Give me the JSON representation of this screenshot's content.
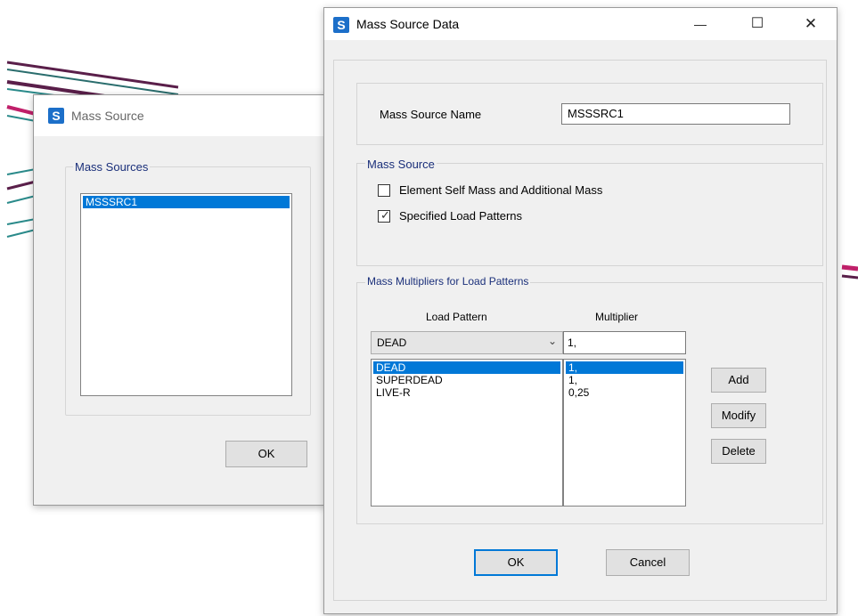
{
  "background_window": {
    "title": "Mass Source",
    "group_title": "Mass Sources",
    "list_items": [
      "MSSSRC1"
    ],
    "ok_label": "OK"
  },
  "dialog": {
    "title": "Mass Source Data",
    "minimize_glyph": "—",
    "maximize_glyph": "☐",
    "close_glyph": "✕",
    "name_label": "Mass Source Name",
    "name_value": "MSSSRC1",
    "mass_source_group": "Mass Source",
    "options": [
      {
        "label": "Element Self Mass and Additional Mass",
        "checked": false
      },
      {
        "label": "Specified Load Patterns",
        "checked": true
      }
    ],
    "multipliers_group": "Mass Multipliers for Load Patterns",
    "col_load_pattern": "Load Pattern",
    "col_multiplier": "Multiplier",
    "combo_value": "DEAD",
    "multiplier_input": "1,",
    "patterns": [
      {
        "name": "DEAD",
        "multiplier": "1,",
        "selected": true
      },
      {
        "name": "SUPERDEAD",
        "multiplier": "1,",
        "selected": false
      },
      {
        "name": "LIVE-R",
        "multiplier": "0,25",
        "selected": false
      }
    ],
    "add_label": "Add",
    "modify_label": "Modify",
    "delete_label": "Delete",
    "ok_label": "OK",
    "cancel_label": "Cancel"
  },
  "icons": {
    "app": "S",
    "dropdown": "⌄"
  },
  "colors": {
    "accent": "#0078d7",
    "group_title": "#1a2f7a",
    "dialog_bg": "#f0f0f0"
  }
}
